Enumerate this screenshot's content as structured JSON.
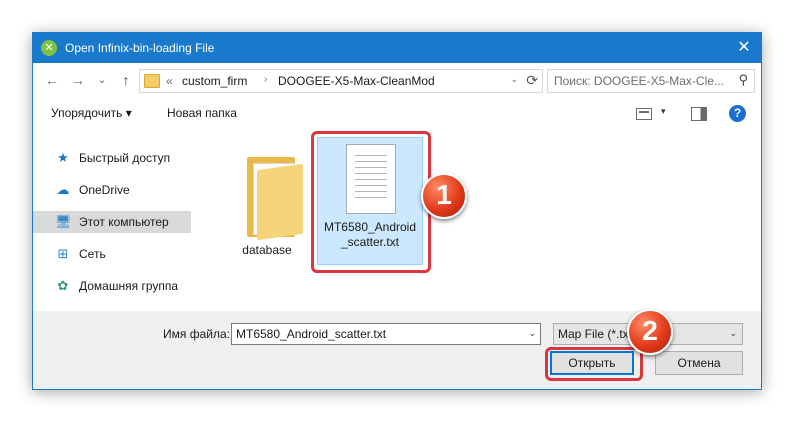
{
  "window": {
    "title": "Open Infinix-bin-loading File",
    "close_glyph": "✕",
    "title_icon_glyph": "✕",
    "accent_color": "#1979ca"
  },
  "nav": {
    "back_icon": "←",
    "forward_icon": "→",
    "recent_icon": "⌄",
    "up_icon": "↑"
  },
  "address": {
    "prefix": "«",
    "crumbs": [
      "custom_firm",
      "DOOGEE-X5-Max-CleanMod"
    ],
    "separator": "›",
    "dropdown_icon": "⌄",
    "refresh_icon": "⟳"
  },
  "search": {
    "placeholder": "Поиск: DOOGEE-X5-Max-Cle...",
    "icon": "search-icon"
  },
  "toolbar": {
    "organize_label": "Упорядочить ▾",
    "new_folder_label": "Новая папка",
    "view_dropdown": "▾",
    "help_glyph": "?"
  },
  "sidebar": {
    "items": [
      {
        "label": "Быстрый доступ",
        "icon": "star-icon",
        "glyph": "★",
        "color": "#1c77c3"
      },
      {
        "label": "OneDrive",
        "icon": "cloud-icon",
        "glyph": "☁",
        "color": "#1c77c3"
      },
      {
        "label": "Этот компьютер",
        "icon": "computer-icon",
        "glyph": "🖥",
        "color": "#3a8ad0",
        "selected": true
      },
      {
        "label": "Сеть",
        "icon": "network-icon",
        "glyph": "⊞",
        "color": "#2f86c9"
      },
      {
        "label": "Домашняя группа",
        "icon": "homegroup-icon",
        "glyph": "✿",
        "color": "#2f9a6b"
      }
    ]
  },
  "files": [
    {
      "name": "database",
      "type": "folder"
    },
    {
      "name_line1": "MT6580_Android",
      "name_line2": "_scatter.txt",
      "type": "text-file",
      "selected": true
    }
  ],
  "badges": {
    "first": "1",
    "second": "2"
  },
  "bottom": {
    "filename_label": "Имя файла:",
    "filename_value": "MT6580_Android_scatter.txt",
    "filter_value": "Map File (*.txt)",
    "open_label": "Открыть",
    "cancel_label": "Отмена",
    "dropdown_glyph": "⌄"
  },
  "colors": {
    "highlight": "#d9363e",
    "selection": "#cce8ff"
  }
}
